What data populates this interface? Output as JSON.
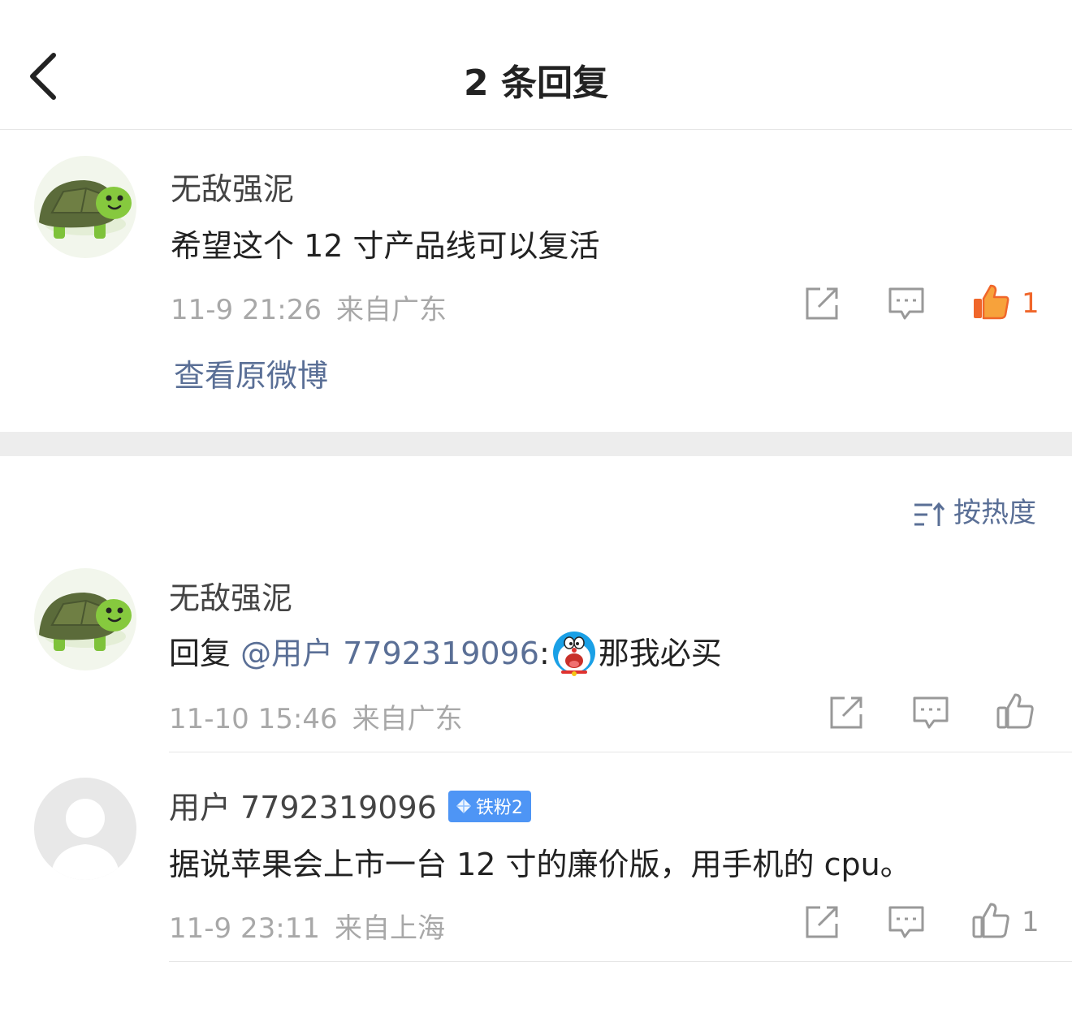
{
  "header": {
    "title": "2 条回复"
  },
  "root_comment": {
    "username": "无敌强泥",
    "content": "希望这个 12 寸产品线可以复活",
    "time": "11-9 21:26",
    "source": "来自广东",
    "like_count": "1",
    "view_original": "查看原微博"
  },
  "sort_label": "按热度",
  "replies": [
    {
      "username": "无敌强泥",
      "reply_prefix": "回复",
      "mention": "@用户 7792319096",
      "colon": ":",
      "text": "那我必买",
      "time": "11-10 15:46",
      "source": "来自广东",
      "like_count": ""
    },
    {
      "username": "用户 7792319096",
      "badge": "铁粉2",
      "content": "据说苹果会上市一台 12 寸的廉价版，用手机的 cpu。",
      "time": "11-9 23:11",
      "source": "来自上海",
      "like_count": "1"
    }
  ],
  "colors": {
    "link": "#5a6f96",
    "like_active": "#f0662a",
    "badge": "#4e95f5",
    "meta": "#a8a8a8"
  }
}
